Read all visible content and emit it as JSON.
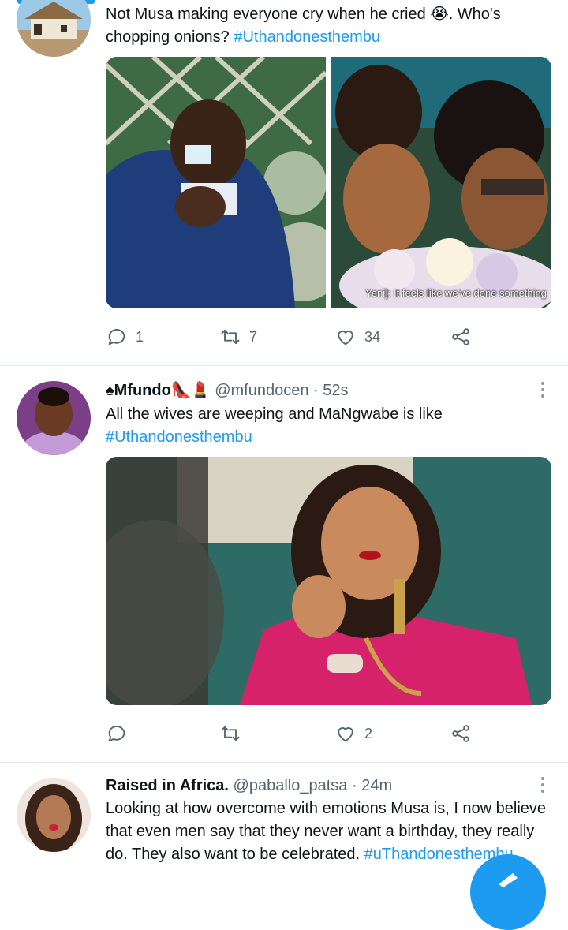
{
  "tweet1": {
    "text_pre": "Not Musa making everyone cry when he cried ",
    "emoji": "😭",
    "text_post": ". Who's chopping onions? ",
    "hashtag": "#Uthandonesthembu",
    "image_caption": "Yeni]: It feels like we've done something",
    "replies": "1",
    "retweets": "7",
    "likes": "34"
  },
  "tweet2": {
    "name": "♠Mfundo👠💄",
    "handle": "@mfundocen",
    "separator": "·",
    "time": "52s",
    "text": "All the wives are weeping and MaNgwabe is like ",
    "hashtag": "#Uthandonesthembu",
    "replies": "",
    "retweets": "",
    "likes": "2"
  },
  "tweet3": {
    "name": "Raised in Africa.",
    "handle": "@paballo_patsa",
    "separator": "·",
    "time": "24m",
    "text": "Looking at how overcome with emotions Musa is,  I now believe that even men say that they never want a birthday, they really do. They also want to be celebrated. ",
    "hashtag": "#uThandonesthembu"
  },
  "icons": {
    "reply": "reply-icon",
    "retweet": "retweet-icon",
    "like": "heart-icon",
    "share": "share-icon",
    "more": "more-vertical-icon",
    "compose": "compose-tweet-icon"
  },
  "colors": {
    "accent": "#1d9bf0",
    "secondary_text": "#536471",
    "primary_text": "#0f1419"
  }
}
